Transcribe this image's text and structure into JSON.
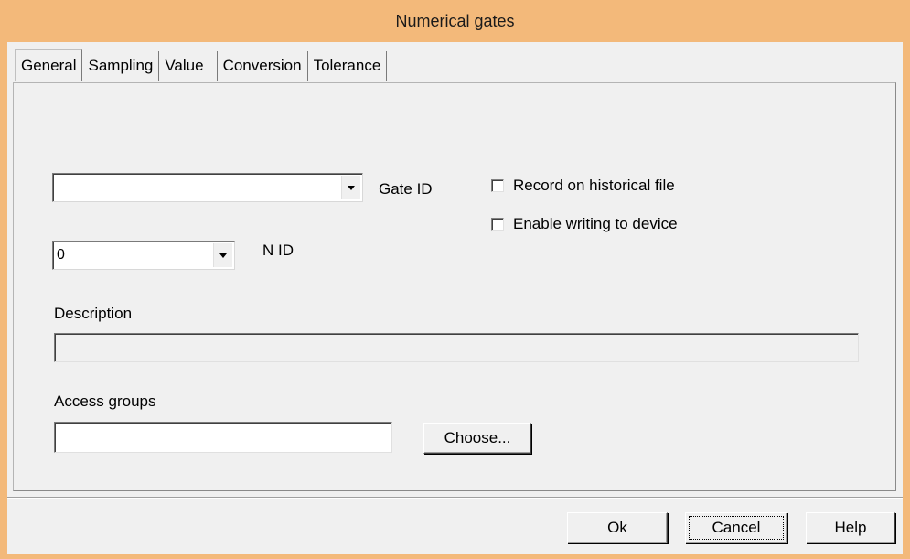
{
  "window": {
    "title": "Numerical gates"
  },
  "tabs": [
    {
      "label": "General",
      "active": true
    },
    {
      "label": "Sampling",
      "active": false
    },
    {
      "label": "Value",
      "active": false
    },
    {
      "label": "Conversion",
      "active": false
    },
    {
      "label": "Tolerance",
      "active": false
    }
  ],
  "general": {
    "gate_id": {
      "value": "",
      "label": "Gate ID"
    },
    "n_id": {
      "value": "0",
      "label": "N ID"
    },
    "record_historical": {
      "label": "Record on historical file",
      "checked": false
    },
    "enable_writing": {
      "label": "Enable writing to device",
      "checked": false
    },
    "description": {
      "label": "Description",
      "value": ""
    },
    "access_groups": {
      "label": "Access groups",
      "value": ""
    },
    "choose_button": "Choose..."
  },
  "footer": {
    "ok": "Ok",
    "cancel": "Cancel",
    "help": "Help"
  },
  "colors": {
    "frame": "#f3b97a",
    "dialog": "#f0f0f0"
  },
  "icons": {
    "dropdown": "chevron-down-icon"
  }
}
